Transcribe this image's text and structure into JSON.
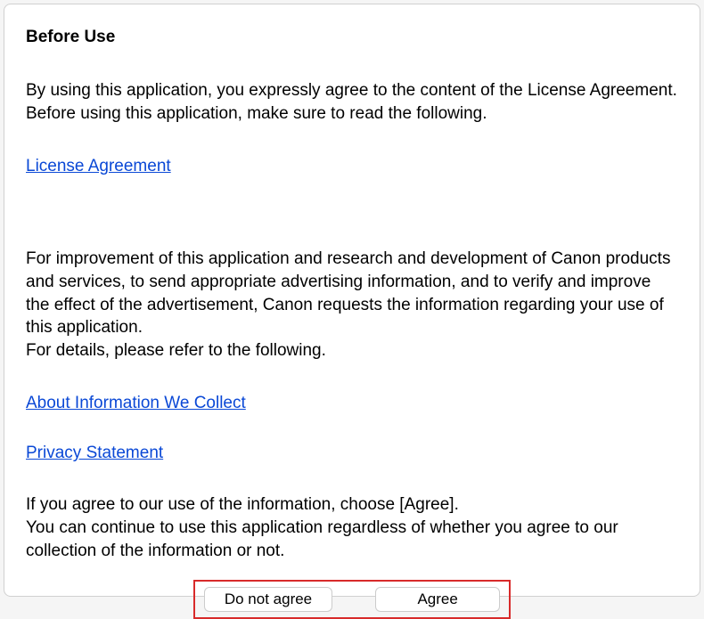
{
  "dialog": {
    "heading": "Before Use",
    "paragraph1": "By using this application, you expressly agree to the content of the License Agreement.\nBefore using this application, make sure to read the following.",
    "link_license": "License Agreement",
    "paragraph2": "For improvement of this application and research and development of Canon products and services, to send appropriate advertising information, and to verify and improve the effect of the advertisement, Canon requests the information regarding your use of this application.\nFor details, please refer to the following.",
    "link_about_info": "About Information We Collect",
    "link_privacy": "Privacy Statement",
    "paragraph3": "If you agree to our use of the information, choose [Agree].\nYou can continue to use this application regardless of whether you agree to our collection of the information or not.",
    "button_do_not_agree": "Do not agree",
    "button_agree": "Agree"
  },
  "highlight_color": "#d82a2a",
  "link_color": "#0a48d6"
}
